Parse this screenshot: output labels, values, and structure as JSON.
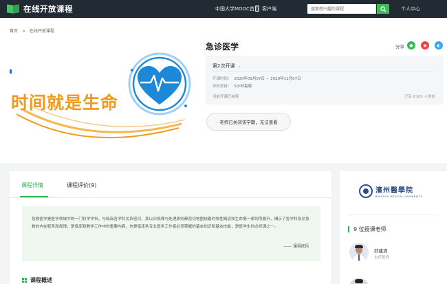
{
  "nav": {
    "logo_text": "在线开放课程",
    "mooc_link": "中国大学MOOC首页",
    "client_link": "客户端",
    "search_placeholder": "搜索感兴趣的课程",
    "profile_link": "个人中心"
  },
  "breadcrumb": {
    "home": "首页",
    "separator": ">",
    "current": "在线开放课程"
  },
  "course": {
    "image_text": "时间就是生命",
    "title": "急诊医学",
    "share_label": "分享",
    "term": "第2次开课",
    "time_label": "开课时间：",
    "time_value": "2020年09月07日 ~ 2020年11月07日",
    "schedule_label": "学时安排：",
    "schedule_value": "5小时每周",
    "status": "当前开课已结束",
    "enrolled": "已有 6169 人参加",
    "closed_button": "老师已关闭该学期，无法查看"
  },
  "tabs": [
    {
      "label": "课程详情"
    },
    {
      "label": "课程评价(9)"
    }
  ],
  "quote": {
    "text": "急救医学是医学领域中的一门科学学科，与临床各学科关系密切，其以识规律与处理原则都密切地图绕着时效性概念和生命第一原则而展开，揭示了各学科急诊急救的内在联系和规律，是临床和教学工作中的重要内容，也是临床各专业医务工作者必须掌握的基本知识和基本技能，是医学生的必修课之一。",
    "sign": "—— 课程团队"
  },
  "section": {
    "overview_title": "课程概述"
  },
  "side": {
    "uni_cn": "濱州醫學院",
    "uni_en": "BINZHOU MEDICAL UNIVERSITY",
    "teacher_count": "9 位授课老师",
    "teacher_name": "邱建清",
    "teacher_title": "主任医师"
  },
  "colors": {
    "accent": "#2eb24f",
    "nav_bg": "#222a33",
    "banner_orange": "#f39a1e",
    "banner_blue": "#1e88d8"
  }
}
